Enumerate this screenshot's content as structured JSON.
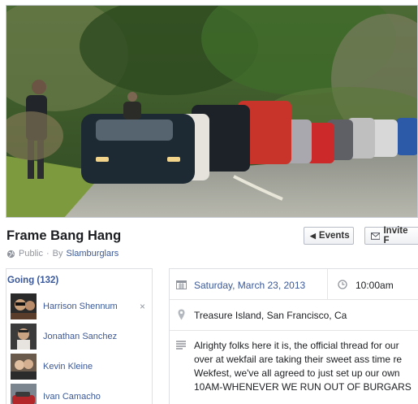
{
  "event": {
    "title": "Frame Bang Hang",
    "privacy": "Public",
    "by_prefix": "By",
    "host": "Slamburglars"
  },
  "actions": {
    "events_label": "Events",
    "invite_label": "Invite F"
  },
  "going": {
    "label": "Going (132)",
    "people": [
      {
        "name": "Harrison Shennum"
      },
      {
        "name": "Jonathan Sanchez"
      },
      {
        "name": "Kevin Kleine"
      },
      {
        "name": "Ivan Camacho"
      }
    ],
    "remove_symbol": "×"
  },
  "details": {
    "date": "Saturday, March 23, 2013",
    "time": "10:00am",
    "location": "Treasure Island, San Francisco, Ca",
    "description_lines": [
      "Alrighty folks here it is, the official thread for our",
      "over at wekfail are taking their sweet ass time re",
      "Wekfest, we've all agreed to just set up our own",
      "10AM-WHENEVER WE RUN OUT OF BURGARS"
    ]
  },
  "icons": {
    "privacy": "globe-icon",
    "events": "chevron-left-icon",
    "invite": "envelope-icon",
    "date": "calendar-icon",
    "time": "clock-icon",
    "location": "map-pin-icon",
    "description": "text-lines-icon"
  },
  "colors": {
    "link": "#3b5998",
    "border": "#dddfe2",
    "muted": "#90949c"
  }
}
